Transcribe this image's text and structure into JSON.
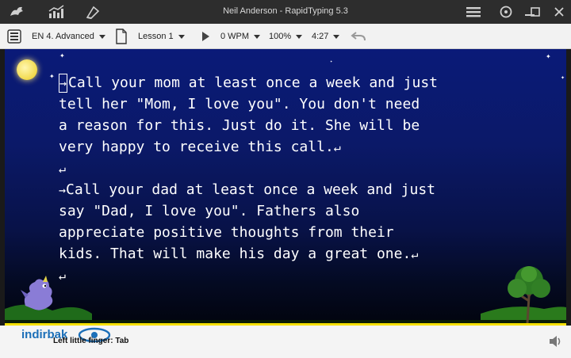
{
  "window": {
    "title": "Neil Anderson - RapidTyping 5.3",
    "controls": [
      "menu-icon",
      "help-icon",
      "minimize-icon",
      "maximize-icon",
      "close-icon"
    ]
  },
  "titlebar_icons": [
    "dragon-logo-icon",
    "statistics-icon",
    "editor-icon"
  ],
  "toolbar": {
    "course": "EN 4. Advanced",
    "lesson": "Lesson 1",
    "speed": "0 WPM",
    "zoom": "100%",
    "time": "4:27"
  },
  "lesson_text": {
    "lines": [
      {
        "glyph": "→",
        "text": "Call your mom at least once a week and just",
        "end": ""
      },
      {
        "glyph": "",
        "text": "tell her \"Mom, I love you\". You don't need",
        "end": ""
      },
      {
        "glyph": "",
        "text": "a reason for this. Just do it. She will be",
        "end": ""
      },
      {
        "glyph": "",
        "text": "very happy to receive this call.",
        "end": "↵"
      },
      {
        "glyph": "",
        "text": "",
        "end": "↵"
      },
      {
        "glyph": "→",
        "text": "Call your dad at least once a week and just",
        "end": ""
      },
      {
        "glyph": "",
        "text": "say \"Dad, I love you\". Fathers also",
        "end": ""
      },
      {
        "glyph": "",
        "text": "appreciate positive thoughts from their",
        "end": ""
      },
      {
        "glyph": "",
        "text": "kids. That will make his day a great one.",
        "end": "↵"
      },
      {
        "glyph": "",
        "text": "",
        "end": "↵"
      }
    ]
  },
  "status": {
    "hint": "Left little finger: Tab",
    "watermark": "indirbak"
  },
  "colors": {
    "titlebar": "#2d2d2d",
    "sky_top": "#0a1a78",
    "sky_bottom": "#02040e",
    "moon": "#f2d94a",
    "accent_edge": "#f5e000"
  }
}
